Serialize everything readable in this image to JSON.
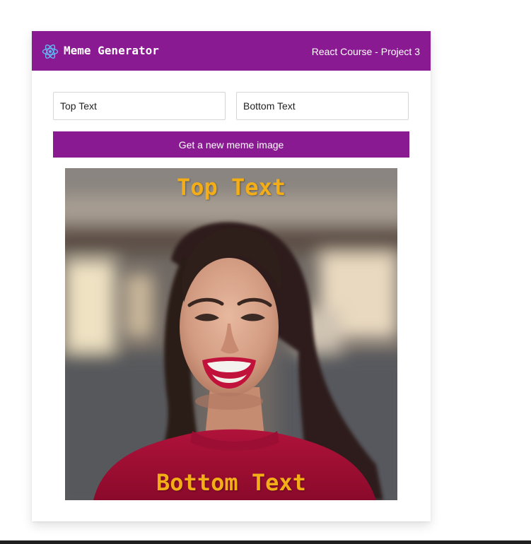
{
  "header": {
    "brand": "Meme Generator",
    "subtitle": "React Course - Project 3",
    "logo_icon": "react-atom-icon"
  },
  "form": {
    "top_text_value": "Top Text",
    "bottom_text_value": "Bottom Text",
    "button_label": "Get a new meme image"
  },
  "meme": {
    "top_text": "Top Text",
    "bottom_text": "Bottom Text",
    "text_color": "#f2ad17"
  },
  "colors": {
    "accent": "#891a91"
  }
}
